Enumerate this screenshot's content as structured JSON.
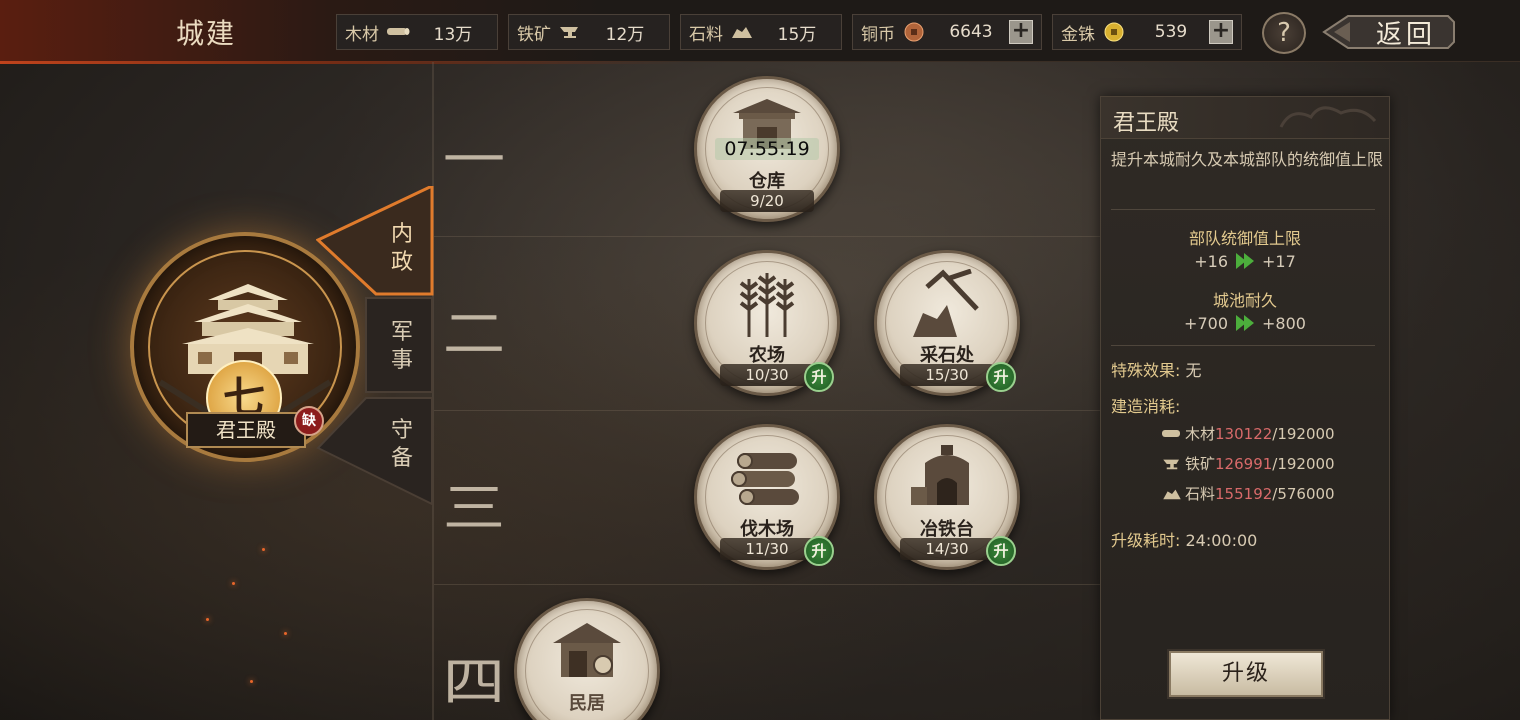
{
  "header": {
    "title": "城建",
    "resources": [
      {
        "name": "木材",
        "icon": "wood-icon",
        "value": "13万"
      },
      {
        "name": "铁矿",
        "icon": "anvil-icon",
        "value": "12万"
      },
      {
        "name": "石料",
        "icon": "stone-icon",
        "value": "15万"
      },
      {
        "name": "铜币",
        "icon": "copper-coin-icon",
        "value": "6643"
      },
      {
        "name": "金铢",
        "icon": "gold-coin-icon",
        "value": "539"
      }
    ],
    "plus": "+",
    "help": "?",
    "back": "返回"
  },
  "tiers": [
    "一",
    "二",
    "三",
    "四"
  ],
  "main_building": {
    "rank": "七",
    "name": "君王殿",
    "missing_badge": "缺"
  },
  "tabs": [
    {
      "label_top": "内",
      "label_bottom": "政",
      "active": true
    },
    {
      "label_top": "军",
      "label_bottom": "事",
      "active": false
    },
    {
      "label_top": "守",
      "label_bottom": "备",
      "active": false
    }
  ],
  "buildings": [
    {
      "name": "仓库",
      "level": "9/20",
      "timer": "07:55:19",
      "icon": "warehouse-icon"
    },
    {
      "name": "农场",
      "level": "10/30",
      "upgrade": "升",
      "icon": "wheat-icon"
    },
    {
      "name": "采石处",
      "level": "15/30",
      "upgrade": "升",
      "icon": "pickaxe-icon"
    },
    {
      "name": "伐木场",
      "level": "11/30",
      "upgrade": "升",
      "icon": "logs-icon"
    },
    {
      "name": "冶铁台",
      "level": "14/30",
      "upgrade": "升",
      "icon": "furnace-icon"
    },
    {
      "name": "民居",
      "icon": "house-icon"
    }
  ],
  "panel": {
    "title": "君王殿",
    "description": "提升本城耐久及本城部队的统御值上限",
    "stats": [
      {
        "name": "部队统御值上限",
        "from": "+16",
        "to": "+17"
      },
      {
        "name": "城池耐久",
        "from": "+700",
        "to": "+800"
      }
    ],
    "special_label": "特殊效果:",
    "special_value": "无",
    "cost_label": "建造消耗:",
    "costs": [
      {
        "name": "木材",
        "icon": "wood-icon",
        "have": "130122",
        "need": "/192000"
      },
      {
        "name": "铁矿",
        "icon": "anvil-icon",
        "have": "126991",
        "need": "/192000"
      },
      {
        "name": "石料",
        "icon": "stone-icon",
        "have": "155192",
        "need": "/576000"
      }
    ],
    "time_label": "升级耗时:",
    "time_value": "24:00:00",
    "upgrade_button": "升级"
  },
  "colors": {
    "accent_orange": "#c0431c",
    "gold": "#e2c98e",
    "insufficient_red": "#d86a6a",
    "upgrade_green": "#3c8a3c"
  }
}
